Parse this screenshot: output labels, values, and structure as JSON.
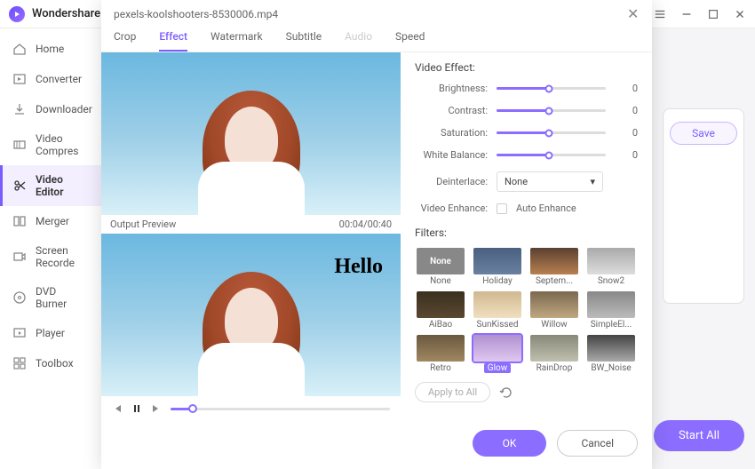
{
  "app": {
    "title": "Wondershare"
  },
  "window_controls": {
    "menu": "menu",
    "min": "min",
    "max": "max",
    "close": "close"
  },
  "sidebar": {
    "items": [
      {
        "label": "Home"
      },
      {
        "label": "Converter"
      },
      {
        "label": "Downloader"
      },
      {
        "label": "Video Compres"
      },
      {
        "label": "Video Editor"
      },
      {
        "label": "Merger"
      },
      {
        "label": "Screen Recorde"
      },
      {
        "label": "DVD Burner"
      },
      {
        "label": "Player"
      },
      {
        "label": "Toolbox"
      }
    ]
  },
  "main": {
    "save_btn": "Save",
    "start_all": "Start All"
  },
  "dialog": {
    "title": "pexels-koolshooters-8530006.mp4",
    "tabs": [
      {
        "label": "Crop"
      },
      {
        "label": "Effect"
      },
      {
        "label": "Watermark"
      },
      {
        "label": "Subtitle"
      },
      {
        "label": "Audio"
      },
      {
        "label": "Speed"
      }
    ],
    "preview": {
      "label": "Output Preview",
      "time": "00:04/00:40",
      "overlay_text": "Hello"
    },
    "effect": {
      "section": "Video Effect:",
      "sliders": [
        {
          "label": "Brightness:",
          "value": "0"
        },
        {
          "label": "Contrast:",
          "value": "0"
        },
        {
          "label": "Saturation:",
          "value": "0"
        },
        {
          "label": "White Balance:",
          "value": "0"
        }
      ],
      "deinterlace_label": "Deinterlace:",
      "deinterlace_value": "None",
      "enhance_label": "Video Enhance:",
      "enhance_check": "Auto Enhance"
    },
    "filters": {
      "section": "Filters:",
      "items": [
        {
          "name": "None"
        },
        {
          "name": "Holiday"
        },
        {
          "name": "Septem..."
        },
        {
          "name": "Snow2"
        },
        {
          "name": "AiBao"
        },
        {
          "name": "SunKissed"
        },
        {
          "name": "Willow"
        },
        {
          "name": "SimpleEl..."
        },
        {
          "name": "Retro"
        },
        {
          "name": "Glow"
        },
        {
          "name": "RainDrop"
        },
        {
          "name": "BW_Noise"
        }
      ],
      "apply_all": "Apply to All"
    },
    "footer": {
      "ok": "OK",
      "cancel": "Cancel"
    }
  }
}
